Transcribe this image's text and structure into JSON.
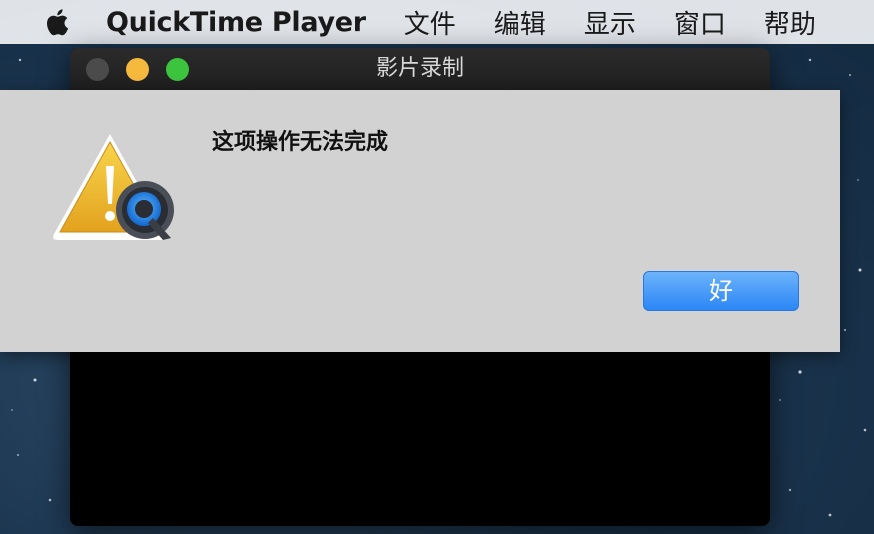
{
  "menubar": {
    "apple_icon": "apple-logo-icon",
    "app_name": "QuickTime Player",
    "items": [
      "文件",
      "编辑",
      "显示",
      "窗口",
      "帮助"
    ]
  },
  "window": {
    "title": "影片录制",
    "buttons": [
      "close",
      "minimize",
      "zoom"
    ]
  },
  "alert": {
    "icon": "warning-quicktime-icon",
    "message": "这项操作无法完成",
    "ok_label": "好"
  },
  "colors": {
    "accent": "#2b86f6",
    "menubar_bg": "#e8eaee",
    "alert_bg": "#d2d2d2",
    "close": "#4b4b4b",
    "minimize": "#f5b93e",
    "zoom": "#3dc43f"
  }
}
